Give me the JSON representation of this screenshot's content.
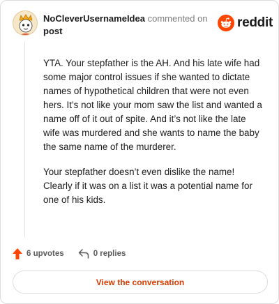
{
  "header": {
    "username": "NoCleverUsernameIdea",
    "action_text": "commented on",
    "post_link": "post"
  },
  "brand": {
    "name": "reddit",
    "icon": "reddit-logo-icon",
    "color": "#ff4500"
  },
  "comment": {
    "paragraphs": [
      "YTA. Your stepfather is the AH. And his late wife had some major control issues if she wanted to dictate names of hypothetical children that were not even hers. It’s not like your mom saw the list and wanted a name off of it out of spite. And it’s not like the late wife was murdered and she wants to name the baby the same name of the murderer.",
      "Your stepfather doesn’t even dislike the name! Clearly if it was on a list it was a potential name for one of his kids."
    ]
  },
  "actions": {
    "upvotes": "6 upvotes",
    "upvote_icon": "upvote-arrow-icon",
    "replies": "0 replies",
    "reply_icon": "reply-arrow-icon"
  },
  "footer": {
    "button_label": "View the conversation"
  },
  "colors": {
    "accent": "#d93a00",
    "upvote": "#ff4500",
    "text": "#1c1c1c",
    "muted": "#7c7c7c"
  }
}
